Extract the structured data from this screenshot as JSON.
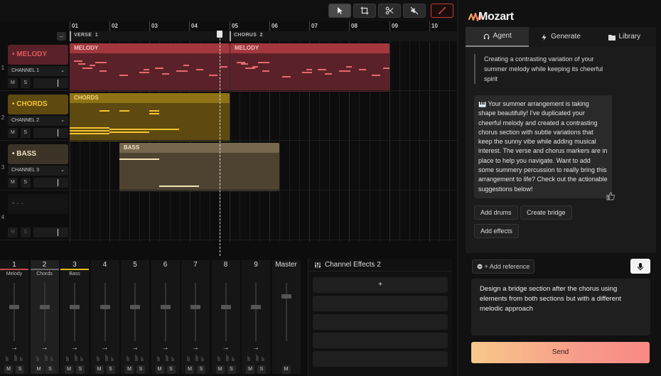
{
  "app": {
    "name": "Mozart"
  },
  "toolbar": {
    "tools": [
      "pointer",
      "select-box",
      "cut",
      "mute",
      "draw"
    ]
  },
  "timeline": {
    "bars": [
      "01",
      "02",
      "03",
      "04",
      "05",
      "06",
      "07",
      "08",
      "09",
      "10"
    ],
    "markers": [
      {
        "label": "VERSE",
        "num": "1"
      },
      {
        "label": "CHORUS",
        "num": "2"
      }
    ]
  },
  "tracks": [
    {
      "row": "1",
      "name": "MELODY",
      "channel": "CHANNEL 1",
      "mute": "M",
      "solo": "S",
      "color": "#c44a4a"
    },
    {
      "row": "2",
      "name": "CHORDS",
      "channel": "CHANNEL 2",
      "mute": "M",
      "solo": "S",
      "color": "#e8b81e"
    },
    {
      "row": "3",
      "name": "BASS",
      "channel": "CHANNEL 3",
      "mute": "M",
      "solo": "S",
      "color": "#c9b58a"
    },
    {
      "row": "4",
      "name": "",
      "channel": "",
      "mute": "M",
      "solo": "S",
      "color": "#444444"
    }
  ],
  "clips": {
    "melody_1": "MELODY",
    "melody_2": "MELODY",
    "chords": "CHORDS",
    "bass": "BASS"
  },
  "mixer": {
    "channels": [
      {
        "num": "1",
        "label": "Melody",
        "accent": "#c44a4a",
        "level": 0.72
      },
      {
        "num": "2",
        "label": "Chords",
        "accent": "#666666",
        "level": 0.72
      },
      {
        "num": "3",
        "label": "Bass",
        "accent": "#e8b81e",
        "level": 0.72
      },
      {
        "num": "4",
        "label": "",
        "accent": "",
        "level": 0.72
      },
      {
        "num": "5",
        "label": "",
        "accent": "",
        "level": 0.72
      },
      {
        "num": "6",
        "label": "",
        "accent": "",
        "level": 0.72
      },
      {
        "num": "7",
        "label": "",
        "accent": "",
        "level": 0.72
      },
      {
        "num": "8",
        "label": "",
        "accent": "",
        "level": 0.72
      },
      {
        "num": "9",
        "label": "",
        "accent": "",
        "level": 0.72
      }
    ],
    "master": {
      "label": "Master",
      "level": 0.8
    },
    "mute": "M",
    "solo": "S",
    "arrow": "→"
  },
  "effects": {
    "title": "Channel Effects 2",
    "add": "+"
  },
  "panel": {
    "tabs": [
      {
        "label": "Agent",
        "icon": "headphones-icon"
      },
      {
        "label": "Generate",
        "icon": "bolt-icon"
      },
      {
        "label": "Library",
        "icon": "folder-icon"
      }
    ],
    "user_message": "Creating a contrasting variation of your summer melody while keeping its cheerful spirit",
    "bot_message": "🎹 Your summer arrangement is taking shape beautifully! I've duplicated your cheerful melody and created a contrasting chorus section with subtle variations that keep the sunny vibe while adding musical interest. The verse and chorus markers are in place to help you navigate. Want to add some summery percussion to really bring this arrangement to life? Check out the actionable suggestions below!",
    "suggestions": [
      "Add drums",
      "Create bridge",
      "Add effects"
    ],
    "add_reference": "+ Add reference",
    "prompt": "Design a bridge section after the chorus using elements from both sections but with a different melodic approach",
    "send": "Send"
  }
}
